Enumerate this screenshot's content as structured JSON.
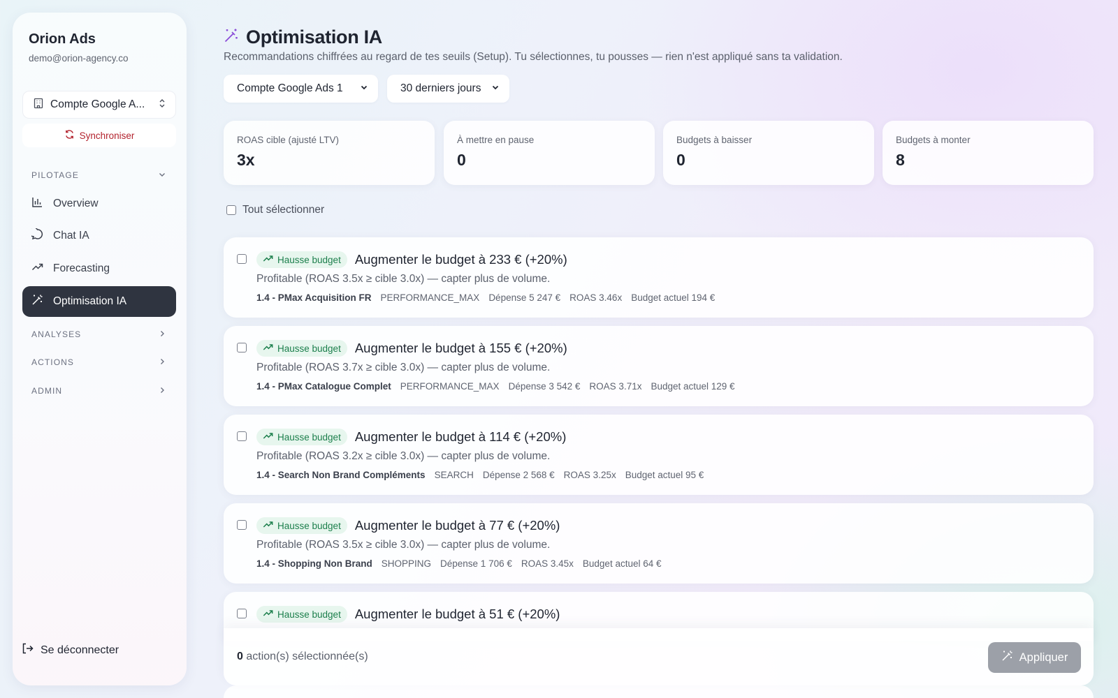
{
  "brand": {
    "name": "Orion Ads",
    "email": "demo@orion-agency.co"
  },
  "account_selector": {
    "label": "Compte Google A..."
  },
  "sync_label": "Synchroniser",
  "nav": {
    "pilotage": "PILOTAGE",
    "items": [
      {
        "label": "Overview",
        "icon": "bar-chart-icon"
      },
      {
        "label": "Chat IA",
        "icon": "chat-bubble-icon"
      },
      {
        "label": "Forecasting",
        "icon": "trending-up-icon"
      },
      {
        "label": "Optimisation IA",
        "icon": "magic-wand-icon",
        "active": true
      }
    ],
    "analyses": "ANALYSES",
    "actions": "ACTIONS",
    "admin": "ADMIN"
  },
  "logout_label": "Se déconnecter",
  "page": {
    "title": "Optimisation IA",
    "subtitle": "Recommandations chiffrées au regard de tes seuils (Setup). Tu sélectionnes, tu pousses — rien n'est appliqué sans ta validation."
  },
  "filters": {
    "account": "Compte Google Ads 1",
    "period": "30 derniers jours"
  },
  "stats": [
    {
      "label": "ROAS cible (ajusté LTV)",
      "value": "3x"
    },
    {
      "label": "À mettre en pause",
      "value": "0"
    },
    {
      "label": "Budgets à baisser",
      "value": "0"
    },
    {
      "label": "Budgets à monter",
      "value": "8"
    }
  ],
  "select_all_label": "Tout sélectionner",
  "recommendations": [
    {
      "badge": "Hausse budget",
      "title": "Augmenter le budget à 233 € (+20%)",
      "desc": "Profitable (ROAS 3.5x ≥ cible 3.0x) — capter plus de volume.",
      "campaign": "1.4 - PMax Acquisition FR",
      "type": "PERFORMANCE_MAX",
      "spend": "Dépense 5 247 €",
      "roas": "ROAS 3.46x",
      "budget": "Budget actuel 194 €"
    },
    {
      "badge": "Hausse budget",
      "title": "Augmenter le budget à 155 € (+20%)",
      "desc": "Profitable (ROAS 3.7x ≥ cible 3.0x) — capter plus de volume.",
      "campaign": "1.4 - PMax Catalogue Complet",
      "type": "PERFORMANCE_MAX",
      "spend": "Dépense 3 542 €",
      "roas": "ROAS 3.71x",
      "budget": "Budget actuel 129 €"
    },
    {
      "badge": "Hausse budget",
      "title": "Augmenter le budget à 114 € (+20%)",
      "desc": "Profitable (ROAS 3.2x ≥ cible 3.0x) — capter plus de volume.",
      "campaign": "1.4 - Search Non Brand Compléments",
      "type": "SEARCH",
      "spend": "Dépense 2 568 €",
      "roas": "ROAS 3.25x",
      "budget": "Budget actuel 95 €"
    },
    {
      "badge": "Hausse budget",
      "title": "Augmenter le budget à 77 € (+20%)",
      "desc": "Profitable (ROAS 3.5x ≥ cible 3.0x) — capter plus de volume.",
      "campaign": "1.4 - Shopping Non Brand",
      "type": "SHOPPING",
      "spend": "Dépense 1 706 €",
      "roas": "ROAS 3.45x",
      "budget": "Budget actuel 64 €"
    },
    {
      "badge": "Hausse budget",
      "title": "Augmenter le budget à 51 € (+20%)"
    }
  ],
  "action_bar": {
    "count": "0",
    "count_suffix": "action(s) sélectionnée(s)",
    "apply_label": "Appliquer"
  },
  "colors": {
    "accent_dark": "#2f3440",
    "badge_green": "#1c7f4c",
    "badge_bg": "#e7f6ee",
    "sync_red": "#b3232e",
    "title_icon_purple": "#8b4dd8"
  }
}
